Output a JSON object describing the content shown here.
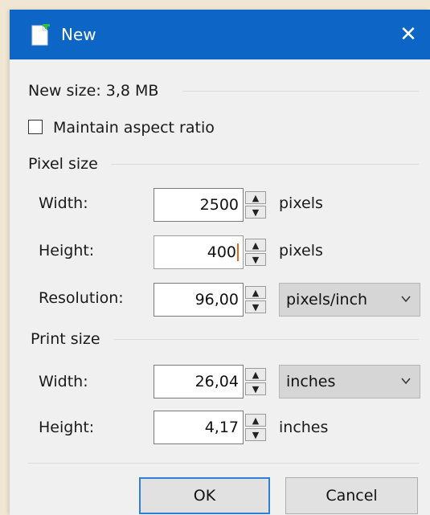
{
  "window": {
    "title": "New",
    "icon": "new-document-icon",
    "close_icon": "close-icon",
    "close_glyph": "✕"
  },
  "summary": {
    "new_size": "New size: 3,8 MB"
  },
  "aspect": {
    "label": "Maintain aspect ratio",
    "checked": false
  },
  "pixel_size": {
    "group_label": "Pixel size",
    "width": {
      "label": "Width:",
      "value": "2500",
      "unit": "pixels"
    },
    "height": {
      "label": "Height:",
      "value": "400",
      "unit": "pixels"
    },
    "resolution": {
      "label": "Resolution:",
      "value": "96,00",
      "unit_selected": "pixels/inch"
    }
  },
  "print_size": {
    "group_label": "Print size",
    "width": {
      "label": "Width:",
      "value": "26,04",
      "unit_selected": "inches"
    },
    "height": {
      "label": "Height:",
      "value": "4,17",
      "unit": "inches"
    }
  },
  "buttons": {
    "ok": "OK",
    "cancel": "Cancel"
  },
  "colors": {
    "titlebar": "#0d66c6",
    "dialog_bg": "#f0f0f0",
    "caret": "#e0671d",
    "desktop": "#f1e6d3"
  }
}
